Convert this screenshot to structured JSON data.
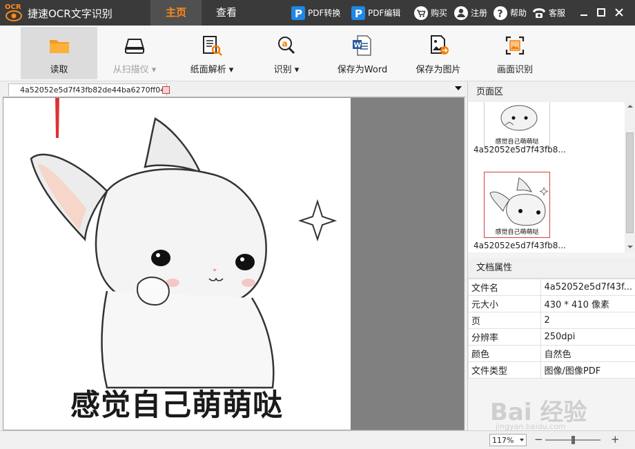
{
  "app": {
    "logo_text": "OCR",
    "title": "捷速OCR文字识别"
  },
  "tabs": [
    {
      "label": "主页",
      "active": true
    },
    {
      "label": "查看",
      "active": false
    }
  ],
  "title_links": [
    {
      "label": "PDF转换",
      "icon": "pdf-convert-icon"
    },
    {
      "label": "PDF编辑",
      "icon": "pdf-edit-icon"
    },
    {
      "label": "购买",
      "icon": "cart-icon"
    },
    {
      "label": "注册",
      "icon": "user-icon"
    },
    {
      "label": "帮助",
      "icon": "help-icon"
    },
    {
      "label": "客服",
      "icon": "phone-icon"
    }
  ],
  "toolbar": {
    "read": "读取",
    "scan": "从扫描仪 ▾",
    "layout": "纸面解析 ▾",
    "recognize": "识别 ▾",
    "save_word": "保存为Word",
    "save_image": "保存为图片",
    "area_recognize": "画面识别"
  },
  "document": {
    "tab_name": "4a52052e5d7f43fb82de44ba6270ff04",
    "caption": "感觉自己萌萌哒"
  },
  "page_panel": {
    "title": "页面区",
    "thumbs": [
      {
        "name": "4a52052e5d7f43fb8...",
        "caption": "感觉自己萌萌哒",
        "selected": false
      },
      {
        "name": "4a52052e5d7f43fb8...",
        "caption": "感觉自己萌萌哒",
        "selected": true
      }
    ]
  },
  "properties": {
    "title": "文档属性",
    "rows": [
      {
        "key": "文件名",
        "value": "4a52052e5d7f43f..."
      },
      {
        "key": "元大小",
        "value": "430 * 410 像素"
      },
      {
        "key": "页",
        "value": "2"
      },
      {
        "key": "分辨率",
        "value": "250dpi"
      },
      {
        "key": "颜色",
        "value": "自然色"
      },
      {
        "key": "文件类型",
        "value": "图像/图像PDF"
      }
    ]
  },
  "status": {
    "zoom": "117%",
    "zoom_level": 0.5
  },
  "watermark": {
    "brand": "Bai 经验",
    "url": "jingyan.baidu.com"
  },
  "colors": {
    "accent": "#ff8a1a",
    "titlebar": "#3a3a3a",
    "arrow": "#e03030"
  }
}
